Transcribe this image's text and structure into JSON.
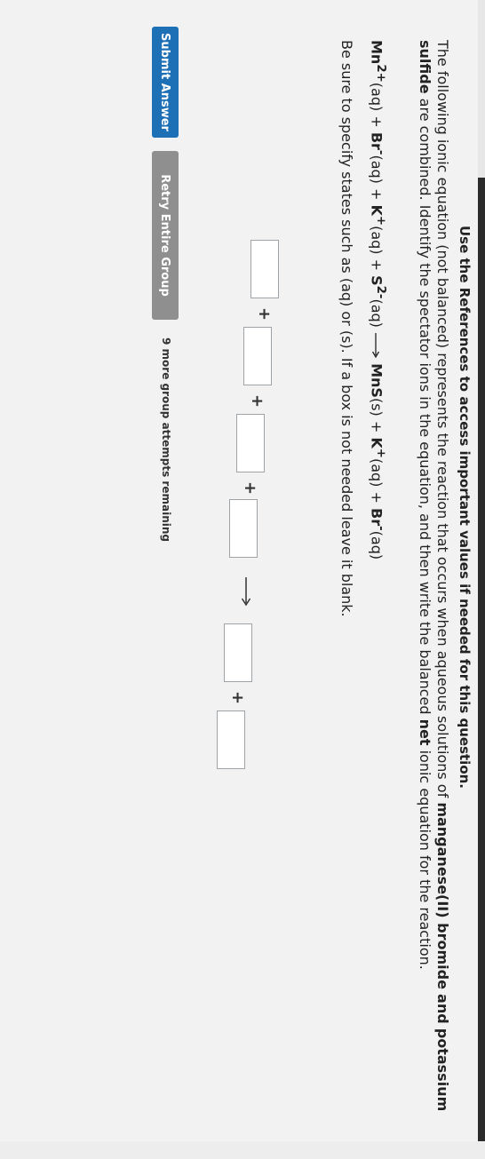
{
  "header": {
    "references": "Use the References to access important values if needed for this question."
  },
  "question": {
    "intro": "The following ionic equation (not balanced) represents the reaction that occurs when aqueous solutions of",
    "compound1": "manganese(II) bromide",
    "and": "and",
    "compound2": "potassium sulfide",
    "mid": "are combined. Identify the spectator ions in the equation, and then write the balanced",
    "net": "net",
    "end": "ionic equation for the reaction."
  },
  "equation": {
    "mn": "Mn",
    "mn_sup": "2+",
    "mn_state": "(aq)",
    "plus": "+",
    "br": "Br",
    "br_sup": "-",
    "br_state": "(aq)",
    "k": "K",
    "k_sup": "+",
    "k_state": "(aq)",
    "s": "S",
    "s_sup": "2-",
    "s_state": "(aq)",
    "mns": "MnS",
    "mns_state": "(s)",
    "k2": "K",
    "k2_sup": "+",
    "k2_state": "(aq)",
    "br2": "Br",
    "br2_sup": "-",
    "br2_state": "(aq)"
  },
  "instructions": "Be sure to specify states such as (aq) or (s). If a box is not needed leave it blank.",
  "answer_row": {
    "plus": "+"
  },
  "buttons": {
    "submit": "Submit Answer",
    "retry": "Retry Entire Group"
  },
  "attempts": "9 more group attempts remaining"
}
